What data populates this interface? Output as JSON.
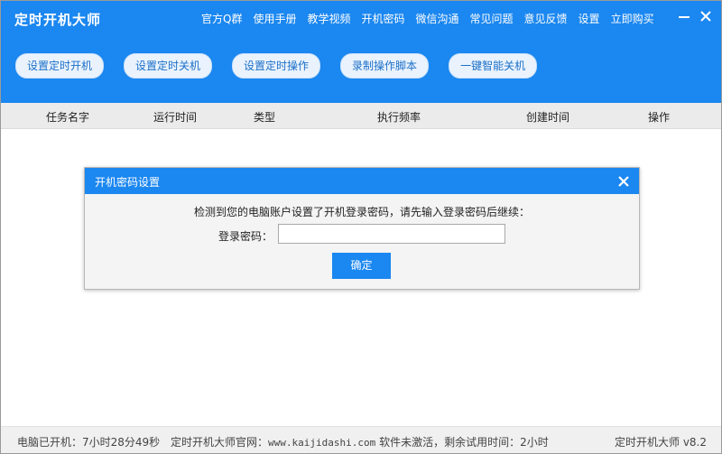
{
  "app": {
    "title": "定时开机大师"
  },
  "nav": {
    "items": [
      {
        "label": "官方Q群"
      },
      {
        "label": "使用手册"
      },
      {
        "label": "教学视频"
      },
      {
        "label": "开机密码"
      },
      {
        "label": "微信沟通"
      },
      {
        "label": "常见问题"
      },
      {
        "label": "意见反馈"
      },
      {
        "label": "设置"
      },
      {
        "label": "立即购买"
      }
    ]
  },
  "toolbar": {
    "buttons": [
      {
        "label": "设置定时开机"
      },
      {
        "label": "设置定时关机"
      },
      {
        "label": "设置定时操作"
      },
      {
        "label": "录制操作脚本"
      },
      {
        "label": "一键智能关机"
      }
    ]
  },
  "table": {
    "headers": [
      "任务名字",
      "运行时间",
      "类型",
      "执行频率",
      "创建时间",
      "操作"
    ]
  },
  "dialog": {
    "title": "开机密码设置",
    "message": "检测到您的电脑账户设置了开机登录密码，请先输入登录密码后继续：",
    "password_label": "登录密码：",
    "password_value": "",
    "ok_label": "确定"
  },
  "status": {
    "uptime": "电脑已开机：7小时28分49秒",
    "website_prefix": "定时开机大师官网：",
    "website": "www.kaijidashi.com",
    "trial": "软件未激活，剩余试用时间：2小时",
    "version": "定时开机大师 v8.2"
  },
  "colors": {
    "brand": "#1b87f0",
    "header_bg": "#1b87f0",
    "table_header_bg": "#ebebeb",
    "status_bg": "#f0f0f0"
  },
  "icons": {
    "minimize": "minimize-icon",
    "close": "close-icon",
    "dialog_close": "close-icon"
  }
}
